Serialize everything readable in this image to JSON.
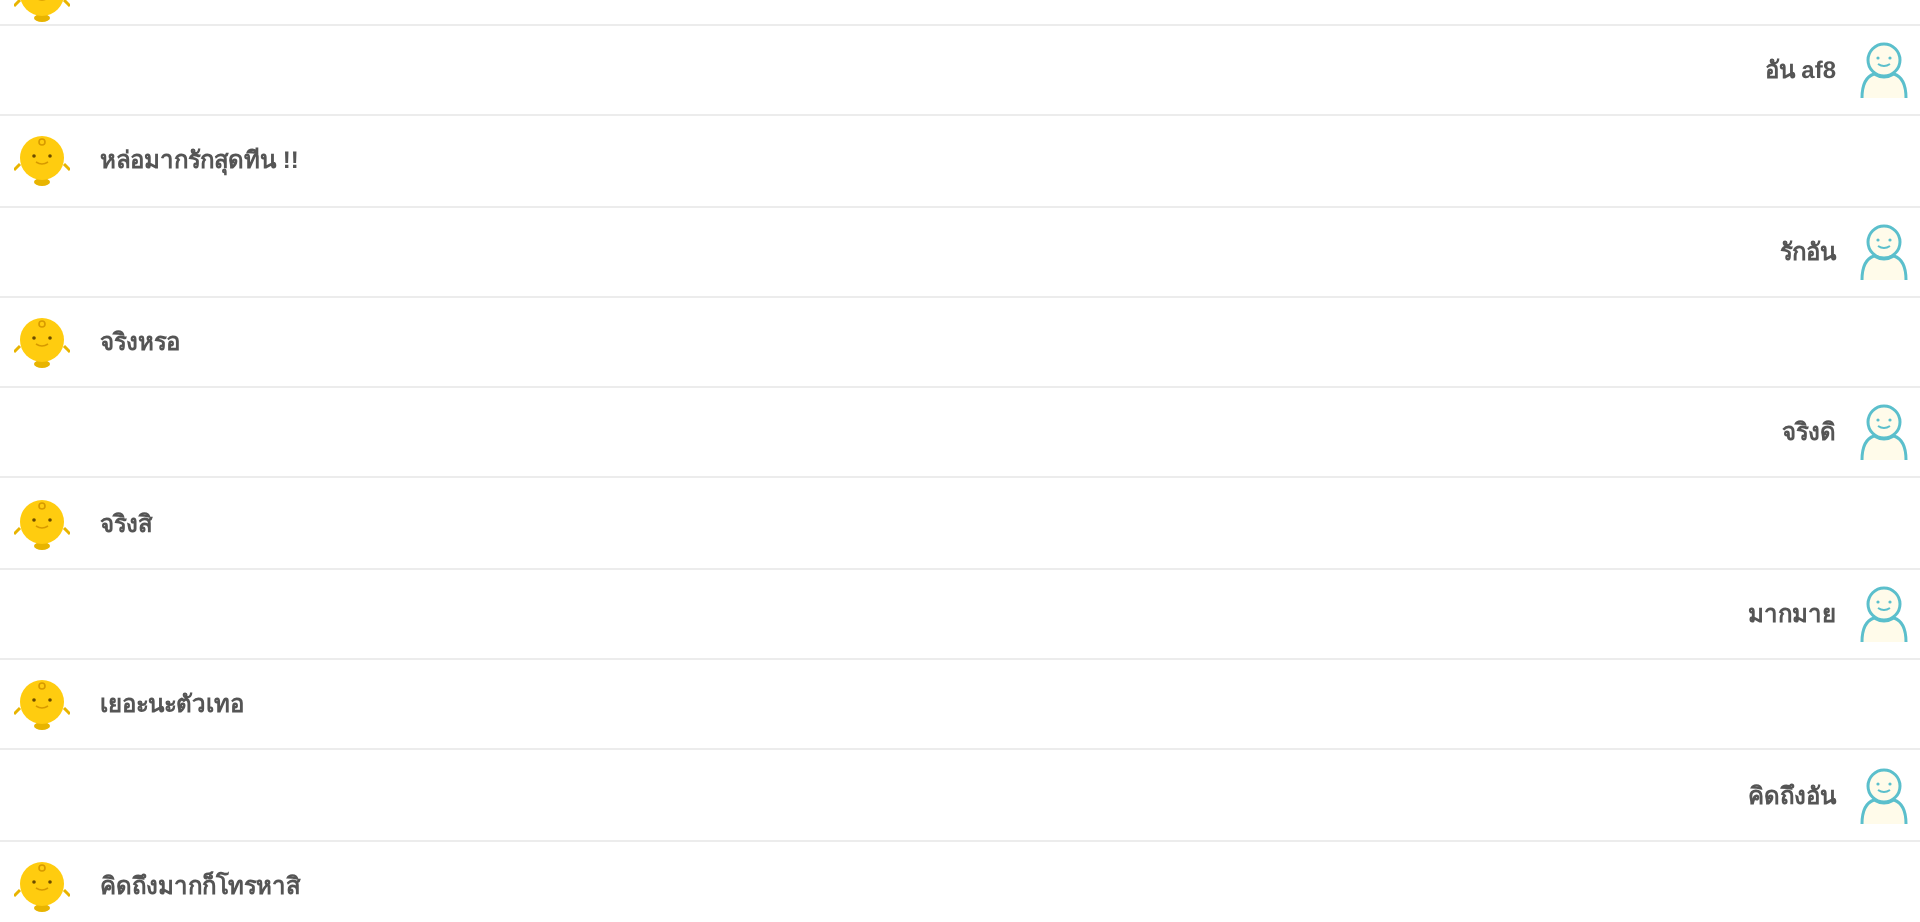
{
  "messages": [
    {
      "kind": "bot"
    },
    {
      "kind": "user",
      "text": "อัน af8"
    },
    {
      "kind": "bot",
      "text": "หล่อมากรักสุดทีน !!"
    },
    {
      "kind": "user",
      "text": "รักอัน"
    },
    {
      "kind": "bot",
      "text": "จริงหรอ"
    },
    {
      "kind": "user",
      "text": "จริงดิ"
    },
    {
      "kind": "bot",
      "text": "จริงสิ"
    },
    {
      "kind": "user",
      "text": "มากมาย"
    },
    {
      "kind": "bot",
      "text": "เยอะนะตัวเทอ"
    },
    {
      "kind": "user",
      "text": "คิดถึงอัน"
    },
    {
      "kind": "bot",
      "text": "คิดถึงมากก็โทรหาสิ"
    }
  ]
}
